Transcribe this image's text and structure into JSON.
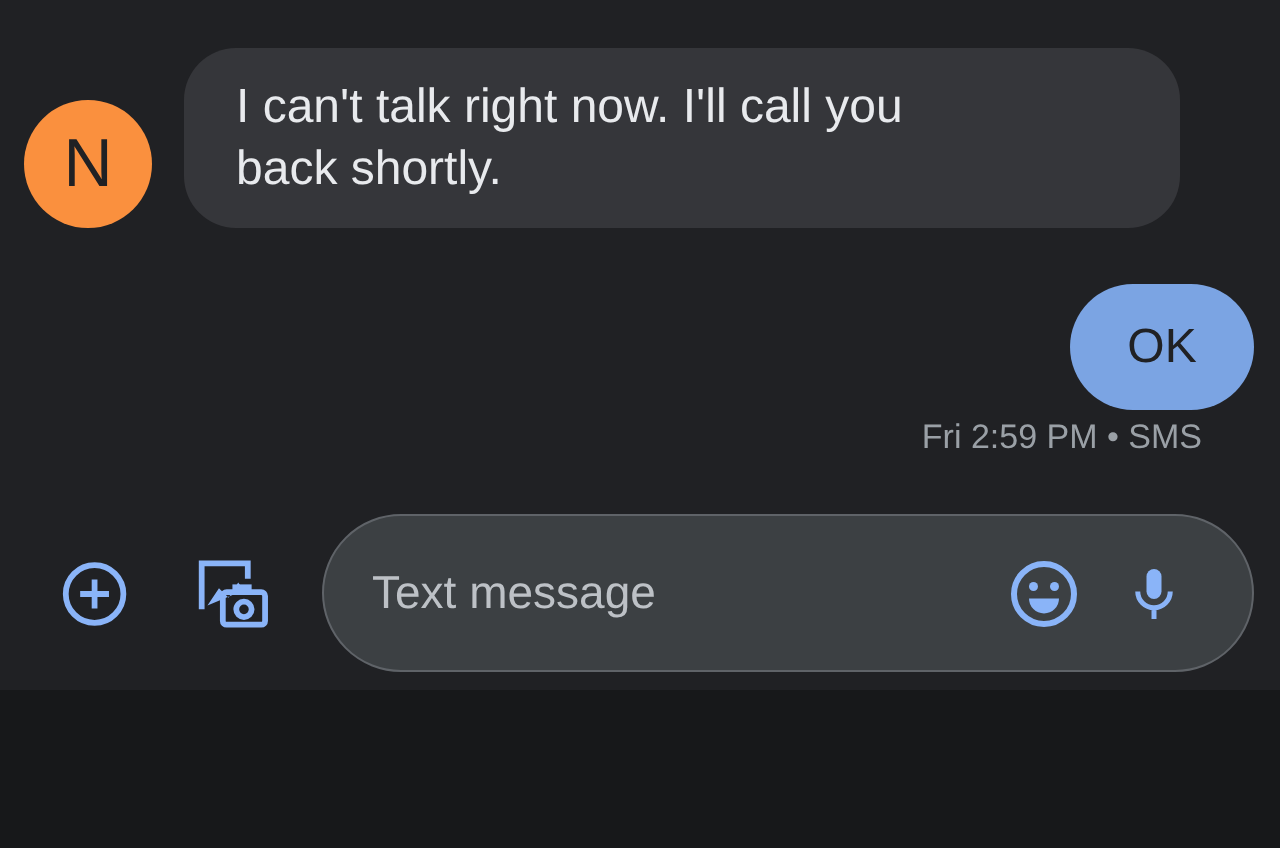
{
  "messages": [
    {
      "kind": "incoming",
      "avatar": {
        "letter": "N",
        "color": "#fa903e"
      },
      "text": "I can't talk right now. I'll call you back shortly."
    },
    {
      "kind": "outgoing",
      "text": "OK",
      "meta": "Fri 2:59 PM • SMS"
    }
  ],
  "compose": {
    "placeholder": "Text message"
  }
}
